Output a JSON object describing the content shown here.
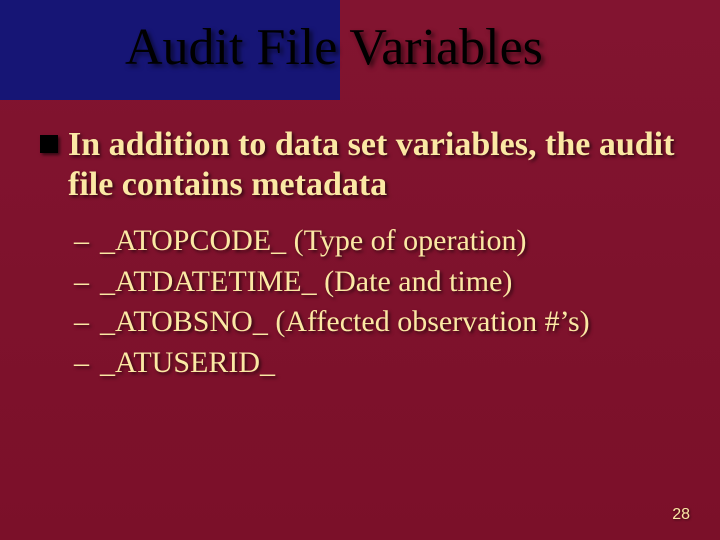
{
  "title": "Audit File Variables",
  "bullet": {
    "text": "In addition to data set variables, the audit file contains metadata"
  },
  "subitems": [
    "_ATOPCODE_ (Type of operation)",
    "_ATDATETIME_ (Date and time)",
    "_ATOBSNO_ (Affected observation #’s)",
    "_ATUSERID_"
  ],
  "page_number": "28"
}
